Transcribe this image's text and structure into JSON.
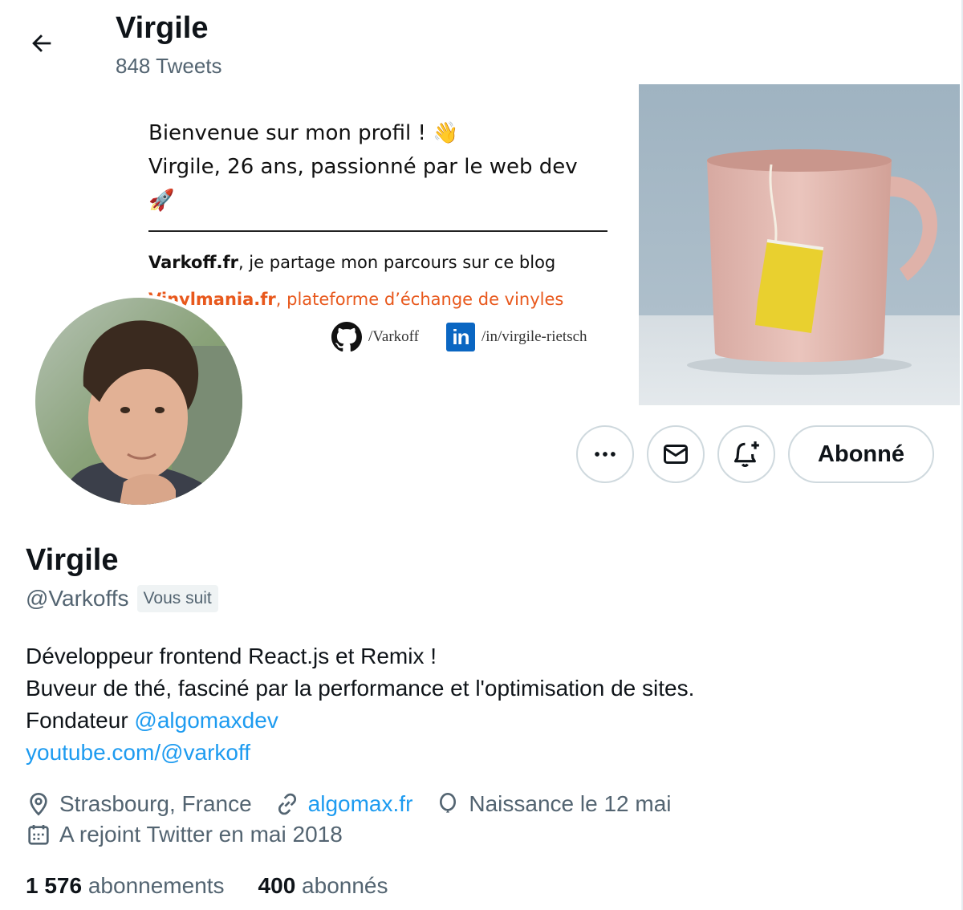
{
  "header": {
    "title": "Virgile",
    "tweet_count": "848 Tweets"
  },
  "banner": {
    "line1": "Bienvenue sur mon profil ! 👋",
    "line2": "Virgile, 26 ans, passionné par le web dev 🚀",
    "blog_bold": "Varkoff.fr",
    "blog_rest": ", je partage mon parcours sur ce blog",
    "vinyl_bold": "Vinylmania.fr",
    "vinyl_rest": ", plateforme d’échange de vinyles",
    "github_handle": "/Varkoff",
    "linkedin_handle": "/in/virgile-rietsch",
    "linkedin_logo": "in"
  },
  "actions": {
    "follow_label": "Abonné"
  },
  "profile": {
    "name": "Virgile",
    "handle": "@Varkoffs",
    "follows_you": "Vous suit",
    "bio_line1": "Développeur frontend React.js et Remix !",
    "bio_line2": "Buveur de thé, fasciné par la performance et l'optimisation de sites.",
    "bio_line3_prefix": "Fondateur ",
    "bio_line3_mention": "@algomaxdev",
    "bio_line4_link": "youtube.com/@varkoff",
    "location": "Strasbourg, France",
    "website": "algomax.fr",
    "birthday": "Naissance le 12 mai",
    "joined": "A rejoint Twitter en mai 2018"
  },
  "stats": {
    "following_count": "1 576",
    "following_label": "abonnements",
    "followers_count": "400",
    "followers_label": "abonnés"
  },
  "colors": {
    "accent": "#1d9bf0",
    "muted": "#536471",
    "orange": "#e8581c"
  }
}
